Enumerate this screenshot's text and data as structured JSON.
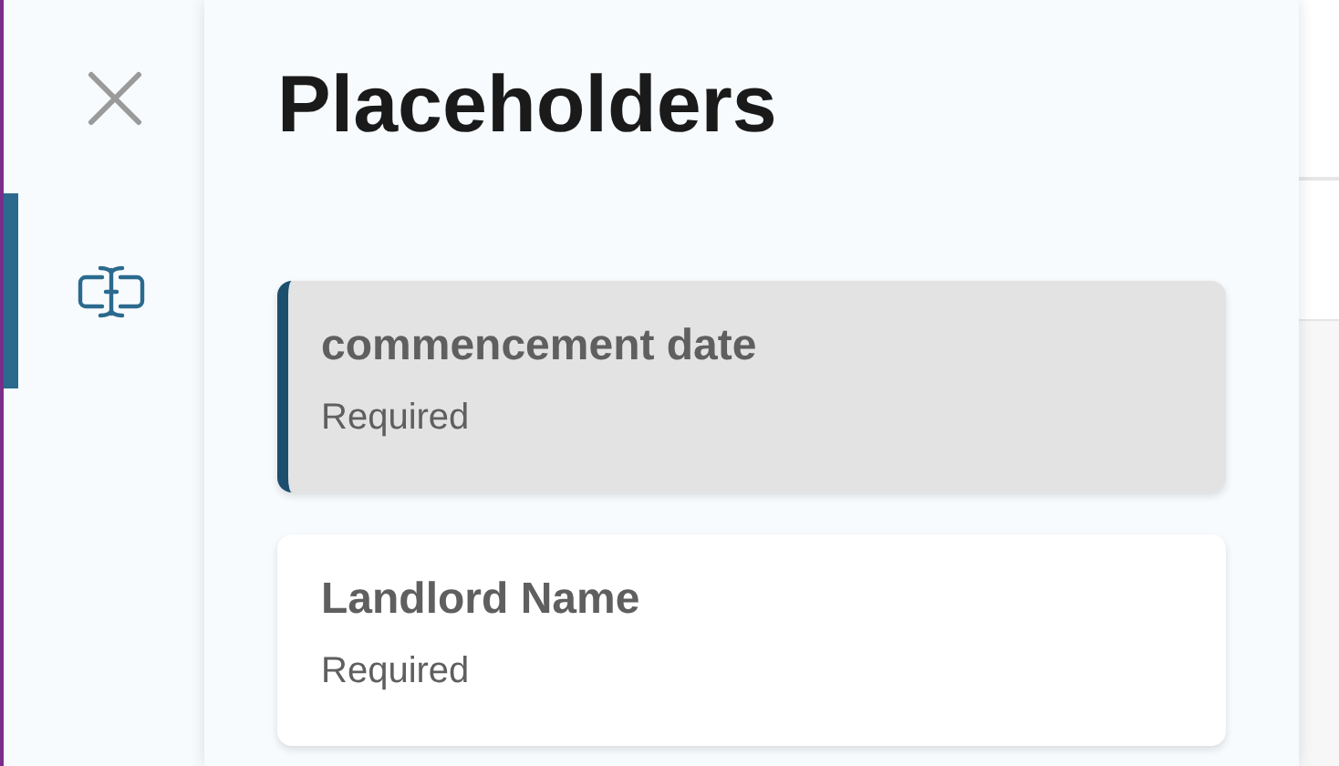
{
  "rail": {
    "items": [
      {
        "kind": "close",
        "selected": false
      },
      {
        "kind": "placeholder",
        "selected": true
      }
    ]
  },
  "panel": {
    "title": "Placeholders",
    "placeholders": [
      {
        "name": "commencement date",
        "status": "Required",
        "selected": true
      },
      {
        "name": "Landlord Name",
        "status": "Required",
        "selected": false
      }
    ]
  }
}
